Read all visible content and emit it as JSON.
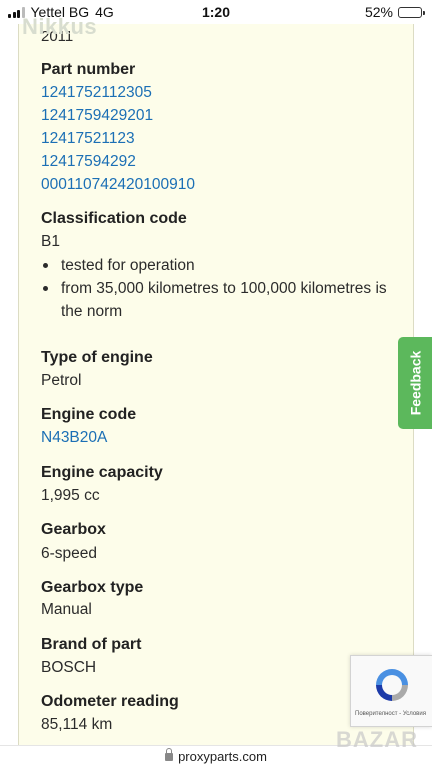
{
  "status_bar": {
    "carrier": "Yettel BG",
    "network": "4G",
    "time": "1:20",
    "battery": "52%",
    "battery_level": 0.52
  },
  "header": {
    "ghost_logo": "Nikkus",
    "cut_value": "2011"
  },
  "details": [
    {
      "label": "Part number",
      "links": [
        "1241752112305",
        "1241759429201",
        "12417521123",
        "12417594292",
        "000110742420100910"
      ]
    },
    {
      "label": "Classification code",
      "value": "B1",
      "bullets": [
        "tested for operation",
        "from 35,000 kilometres to 100,000 kilometres is the norm"
      ]
    },
    {
      "label": "Type of engine",
      "value": "Petrol"
    },
    {
      "label": "Engine code",
      "link": "N43B20A"
    },
    {
      "label": "Engine capacity",
      "value": "1,995 cc"
    },
    {
      "label": "Gearbox",
      "value": "6-speed"
    },
    {
      "label": "Gearbox type",
      "value": "Manual"
    },
    {
      "label": "Brand of part",
      "value": "BOSCH"
    },
    {
      "label": "Odometer reading",
      "value": "85,114 km"
    }
  ],
  "feedback": {
    "label": "Feedback",
    "color": "#5cb85c"
  },
  "captcha": {
    "terms": "Поверителност - Условия"
  },
  "browser": {
    "url": "proxyparts.com"
  },
  "watermark": "BAZAR",
  "colors": {
    "card_bg": "#fdfdea",
    "link": "#1b6fb5"
  }
}
